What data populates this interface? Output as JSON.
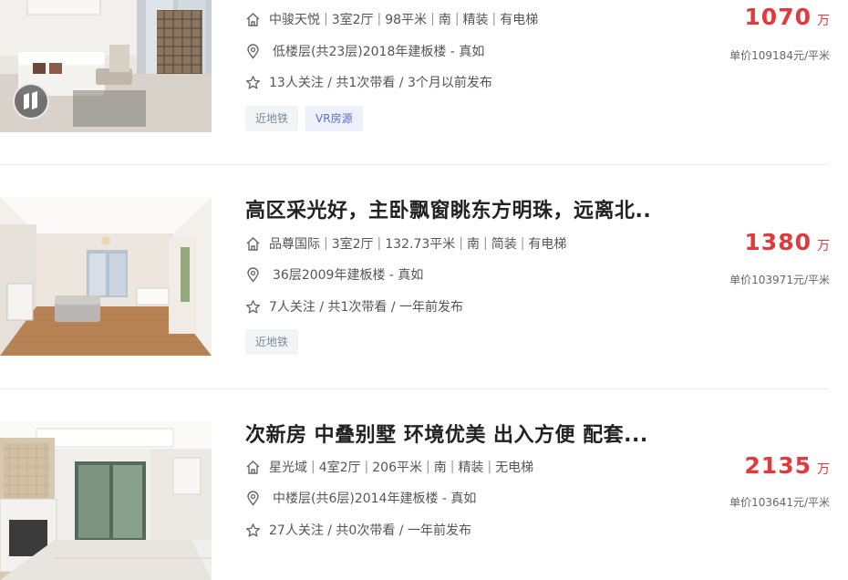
{
  "listings": [
    {
      "title": "",
      "community": "中骏天悦",
      "details": [
        "3室2厅",
        "98平米",
        "南",
        "精装",
        "有电梯"
      ],
      "position": "低楼层(共23层)2018年建板楼 - 真如",
      "followers": "13人关注 / 共1次带看 / 3个月以前发布",
      "tags": [
        "近地铁",
        "VR房源"
      ],
      "price": "1070",
      "price_unit": "万",
      "unit_price": "单价109184元/平米",
      "has_vr_badge": true
    },
    {
      "title": "高区采光好，主卧飘窗眺东方明珠，远离北..",
      "community": "品尊国际",
      "details": [
        "3室2厅",
        "132.73平米",
        "南",
        "简装",
        "有电梯"
      ],
      "position": "36层2009年建板楼 - 真如",
      "followers": "7人关注 / 共1次带看 / 一年前发布",
      "tags": [
        "近地铁"
      ],
      "price": "1380",
      "price_unit": "万",
      "unit_price": "单价103971元/平米",
      "has_vr_badge": false
    },
    {
      "title": "次新房 中叠别墅 环境优美 出入方便 配套...",
      "community": "星光域",
      "details": [
        "4室2厅",
        "206平米",
        "南",
        "精装",
        "无电梯"
      ],
      "position": "中楼层(共6层)2014年建板楼 - 真如",
      "followers": "27人关注 / 共0次带看 / 一年前发布",
      "tags": [],
      "price": "2135",
      "price_unit": "万",
      "unit_price": "单价103641元/平米",
      "has_vr_badge": false
    }
  ],
  "icons": {
    "house": "house-icon",
    "location": "location-pin-icon",
    "star": "star-icon",
    "vr": "vr-badge-icon"
  },
  "colors": {
    "price": "#e4393c",
    "vr_tag_text": "#5a6fc8",
    "subway_tag_text": "#7a8a9c"
  }
}
